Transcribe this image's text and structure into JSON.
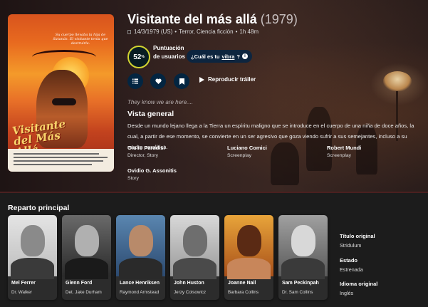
{
  "movie": {
    "title": "Visitante del más allá",
    "year": "(1979)",
    "release": "14/3/1979 (US)",
    "genres": "Terror, Ciencia ficción",
    "runtime": "1h 48m",
    "score": "52",
    "score_unit": "%",
    "score_label": "Puntuación de usuarios",
    "vibe_prefix": "¿Cuál es tu",
    "vibe_link": "vibra",
    "vibe_suffix": "?",
    "trailer_label": "Reproducir tráiler",
    "tagline": "They know we are here....",
    "overview_heading": "Vista general",
    "overview": "Desde un mundo lejano llega a la Tierra un espíritu maligno que se introduce en el cuerpo de una niña de doce años, la cual, a partir de ese momento, se convierte en un ser agresivo que goza viendo sufrir a sus semejantes, incluso a su madre paralítica."
  },
  "poster": {
    "tagline": "Su cuerpo llevaba la hija de Satanás. El visitante tenía que destruirla.",
    "title": "Visitante del Más Allá"
  },
  "crew": [
    {
      "name": "Giulio Paradisi",
      "job": "Director, Story"
    },
    {
      "name": "Luciano Comici",
      "job": "Screenplay"
    },
    {
      "name": "Robert Mundi",
      "job": "Screenplay"
    },
    {
      "name": "Ovidio G. Assonitis",
      "job": "Story"
    }
  ],
  "cast_heading": "Reparto principal",
  "cast": [
    {
      "name": "Mel Ferrer",
      "role": "Dr. Walker"
    },
    {
      "name": "Glenn Ford",
      "role": "Det. Jake Durham"
    },
    {
      "name": "Lance Henriksen",
      "role": "Raymond Armstead"
    },
    {
      "name": "John Huston",
      "role": "Jerzy Colsowicz"
    },
    {
      "name": "Joanne Nail",
      "role": "Barbara Collins"
    },
    {
      "name": "Sam Peckinpah",
      "role": "Dr. Sam Collins"
    }
  ],
  "facts": [
    {
      "label": "Título original",
      "value": "Stridulum"
    },
    {
      "label": "Estado",
      "value": "Estrenada"
    },
    {
      "label": "Idioma original",
      "value": "Inglés"
    }
  ],
  "icons": {
    "list": "list-icon",
    "favorite": "heart-icon",
    "watchlist": "bookmark-icon",
    "play": "play-icon",
    "info": "info-icon",
    "certification": "certification-icon"
  },
  "colors": {
    "score_ring": "#d2d531",
    "button_bg": "#032541",
    "vibe_bg": "#0d253f",
    "page_bg": "#1c1c1c"
  }
}
